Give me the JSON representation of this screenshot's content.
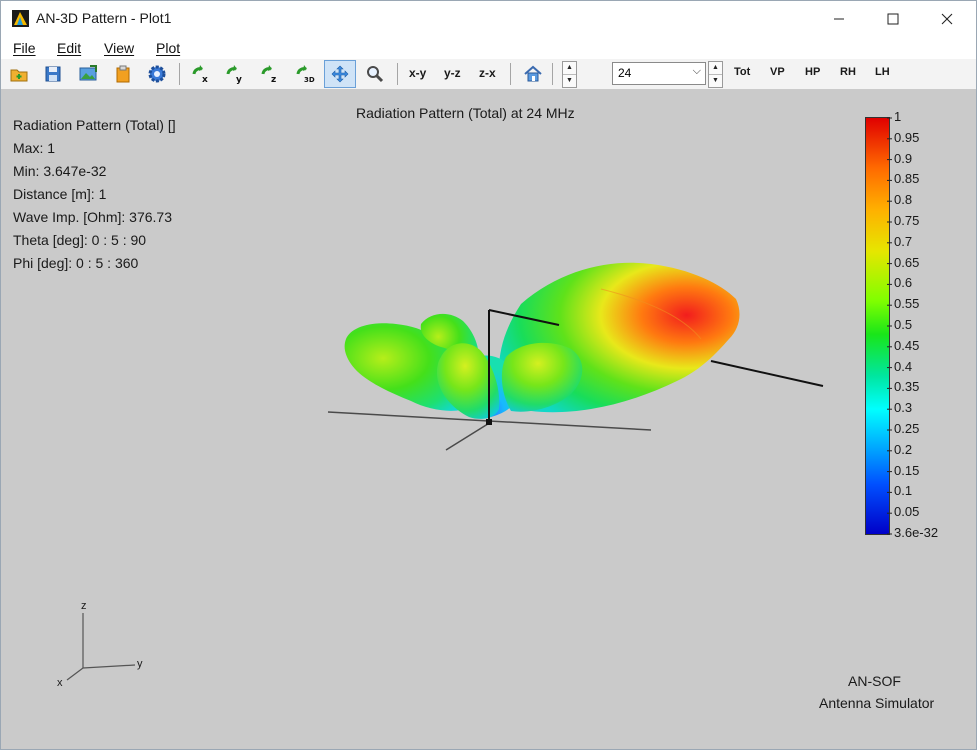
{
  "window": {
    "title": "AN-3D Pattern - Plot1"
  },
  "menu": [
    "File",
    "Edit",
    "View",
    "Plot"
  ],
  "toolbar": {
    "view_buttons": [
      "x-y",
      "y-z",
      "z-x"
    ],
    "frequency": "24",
    "pol_buttons": [
      "Tot",
      "VP",
      "HP",
      "RH",
      "LH"
    ]
  },
  "info": [
    "Radiation Pattern (Total) []",
    "Max: 1",
    "Min: 3.647e-32",
    "Distance [m]: 1",
    "Wave Imp. [Ohm]: 376.73",
    "Theta [deg]: 0 : 5 : 90",
    "Phi [deg]: 0 : 5 : 360"
  ],
  "plot_title": "Radiation Pattern (Total) at 24 MHz",
  "colorbar": {
    "labels": [
      "1",
      "0.95",
      "0.9",
      "0.85",
      "0.8",
      "0.75",
      "0.7",
      "0.65",
      "0.6",
      "0.55",
      "0.5",
      "0.45",
      "0.4",
      "0.35",
      "0.3",
      "0.25",
      "0.2",
      "0.15",
      "0.1",
      "0.05",
      "3.6e-32"
    ]
  },
  "triad": {
    "z": "z",
    "y": "y",
    "x": "x"
  },
  "brand": {
    "line1": "AN-SOF",
    "line2": "Antenna Simulator"
  }
}
